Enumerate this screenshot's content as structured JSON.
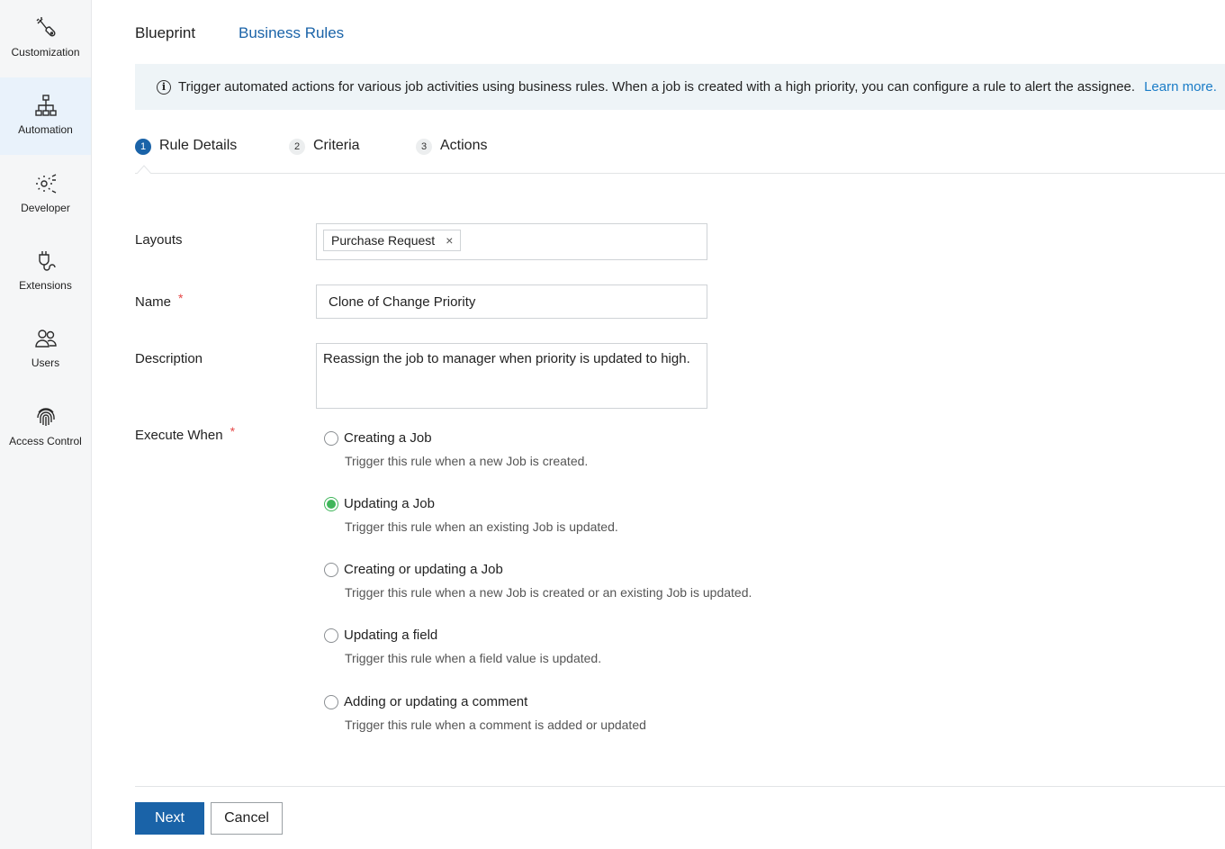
{
  "sidebar": {
    "items": [
      {
        "label": "Customization",
        "icon": "wand-wrench-icon",
        "active": false
      },
      {
        "label": "Automation",
        "icon": "workflow-icon",
        "active": true
      },
      {
        "label": "Developer",
        "icon": "code-gear-icon",
        "active": false
      },
      {
        "label": "Extensions",
        "icon": "plug-icon",
        "active": false
      },
      {
        "label": "Users",
        "icon": "users-icon",
        "active": false
      },
      {
        "label": "Access Control",
        "icon": "fingerprint-icon",
        "active": false
      }
    ]
  },
  "tabs": {
    "blueprint": "Blueprint",
    "business_rules": "Business Rules"
  },
  "banner": {
    "icon": "info-icon",
    "text": "Trigger automated actions for various job activities using business rules. When a job is created with a high priority, you can configure a rule to alert the assignee.",
    "link": "Learn more."
  },
  "steps": [
    {
      "num": "1",
      "label": "Rule Details",
      "active": true
    },
    {
      "num": "2",
      "label": "Criteria",
      "active": false
    },
    {
      "num": "3",
      "label": "Actions",
      "active": false
    }
  ],
  "form": {
    "layouts_label": "Layouts",
    "layouts_chip": "Purchase Request",
    "chip_remove": "×",
    "name_label": "Name",
    "name_value": "Clone of Change Priority",
    "required_mark": "*",
    "description_label": "Description",
    "description_value": "Reassign the job to manager when priority is updated to high.",
    "execute_label": "Execute When",
    "options": [
      {
        "label": "Creating a Job",
        "desc": "Trigger this rule when a new Job is created.",
        "checked": false
      },
      {
        "label": "Updating a Job",
        "desc": "Trigger this rule when an existing Job is updated.",
        "checked": true
      },
      {
        "label": "Creating or updating a Job",
        "desc": "Trigger this rule when a new Job is created or an existing Job is updated.",
        "checked": false
      },
      {
        "label": "Updating a field",
        "desc": "Trigger this rule when a field value is updated.",
        "checked": false
      },
      {
        "label": "Adding or updating a comment",
        "desc": "Trigger this rule when a comment is added or updated",
        "checked": false
      }
    ]
  },
  "footer": {
    "next_label": "Next",
    "cancel_label": "Cancel"
  },
  "colors": {
    "primary": "#1a63a8",
    "link": "#1a7cc7",
    "radio_checked": "#3fb65a",
    "required": "#e54848",
    "banner_bg": "#eef4f7"
  }
}
